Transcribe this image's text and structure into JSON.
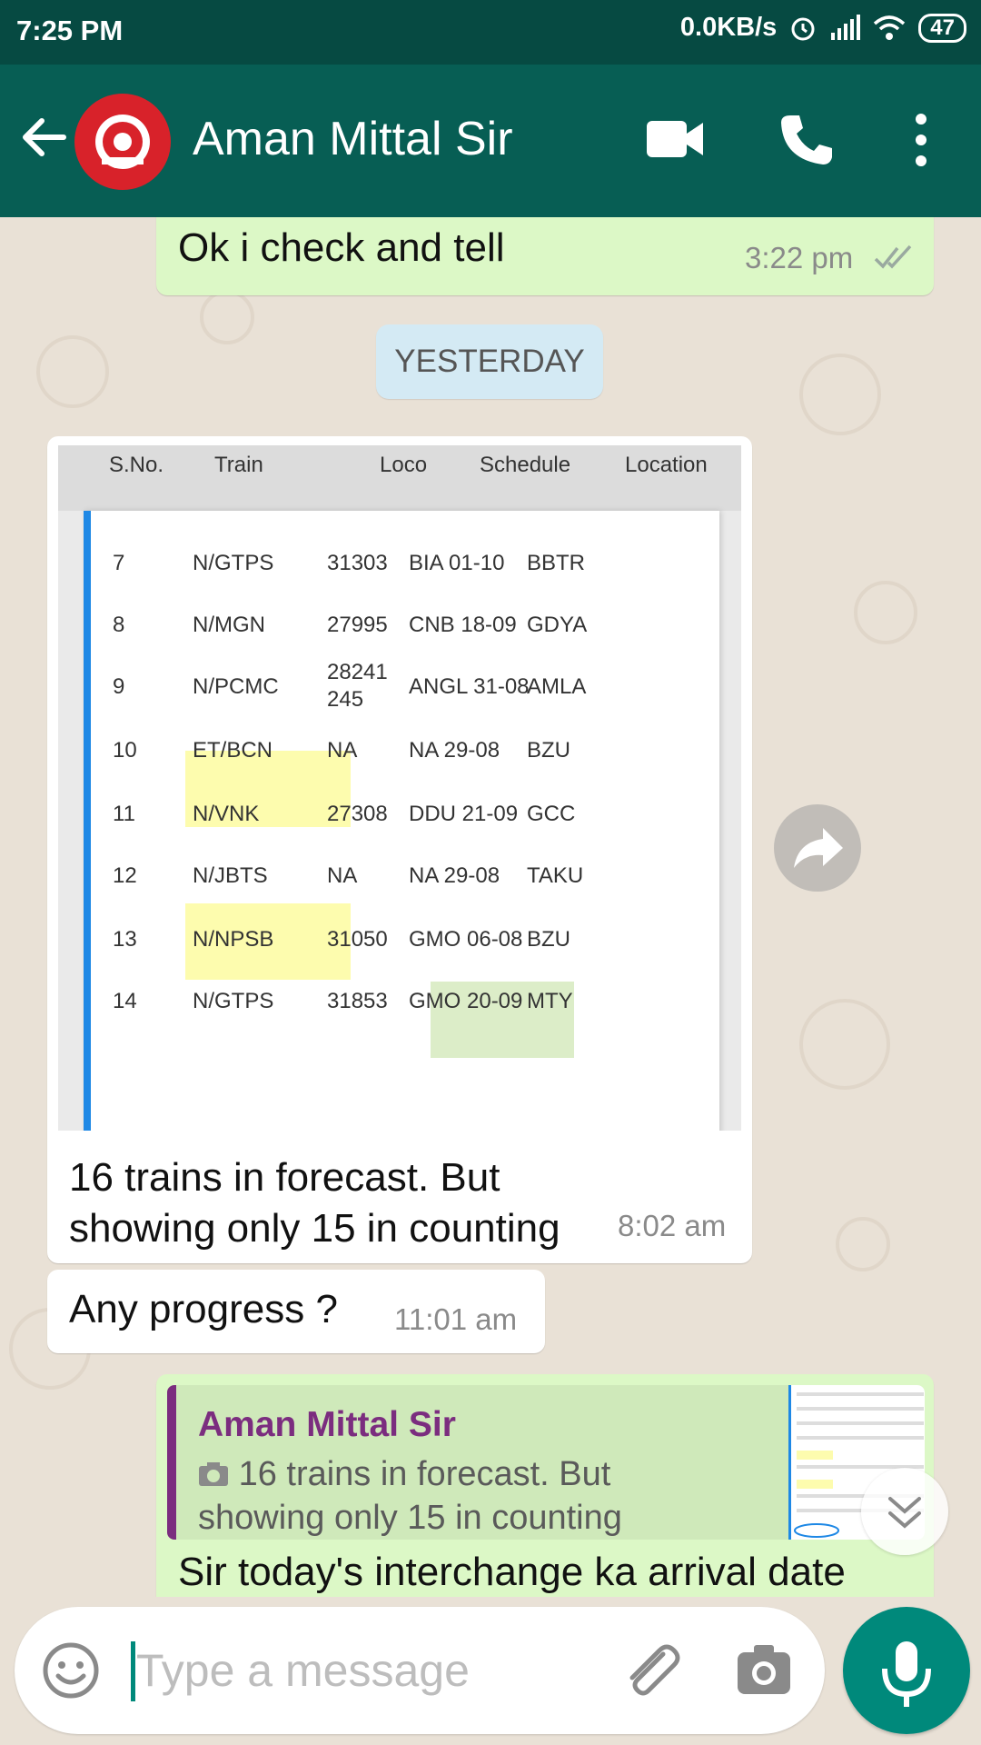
{
  "status_bar": {
    "time": "7:25 PM",
    "network_speed": "0.0KB/s",
    "battery": "47",
    "icons": [
      "alarm-icon",
      "signal-icon",
      "wifi-icon",
      "battery-icon"
    ]
  },
  "header": {
    "contact_name": "Aman Mittal Sir",
    "avatar_text": "INDIAN RAILWAYS",
    "icons": [
      "back-arrow-icon",
      "video-call-icon",
      "phone-call-icon",
      "more-options-icon"
    ]
  },
  "chat": {
    "messages": [
      {
        "direction": "out",
        "text": "Ok i check and tell",
        "time": "3:22 pm",
        "status": "read"
      },
      {
        "direction": "in",
        "type": "image",
        "caption": "16 trains in forecast. But showing only 15 in counting",
        "time": "8:02 am"
      },
      {
        "direction": "in",
        "text": "Any progress ?",
        "time": "11:01 am"
      },
      {
        "direction": "out",
        "text_partial": "Sir today's interchange ka arrival date",
        "quoted": {
          "author": "Aman Mittal Sir",
          "text": "16 trains in forecast. But showing only 15 in counting"
        }
      }
    ],
    "date_divider": "YESTERDAY"
  },
  "image_table": {
    "headers": [
      "S.No.",
      "Train",
      "Loco",
      "Schedule",
      "Location"
    ],
    "rows": [
      [
        "7",
        "N/GTPS",
        "31303",
        "BIA 01-10",
        "BBTR"
      ],
      [
        "8",
        "N/MGN",
        "27995",
        "CNB 18-09",
        "GDYA"
      ],
      [
        "9",
        "N/PCMC",
        "28241",
        "ANGL 31-08",
        "AMLA"
      ],
      [
        "10",
        "ET/BCN",
        "NA",
        "NA 29-08",
        "BZU"
      ],
      [
        "11",
        "N/VNK",
        "27308",
        "DDU 21-09",
        "GCC"
      ],
      [
        "12",
        "N/JBTS",
        "NA",
        "NA 29-08",
        "TAKU"
      ],
      [
        "13",
        "N/NPSB",
        "31050",
        "GMO 06-08",
        "BZU"
      ],
      [
        "14",
        "N/GTPS",
        "31853",
        "GMO 20-09",
        "MTY"
      ]
    ],
    "row9_loco_line2": "245"
  },
  "input": {
    "placeholder": "Type a message"
  },
  "colors": {
    "header": "#075e54",
    "status_bar": "#064a42",
    "outgoing_bubble": "#dcf8c6",
    "incoming_bubble": "#ffffff",
    "accent": "#00897b",
    "quote_author": "#7b2d7f"
  }
}
